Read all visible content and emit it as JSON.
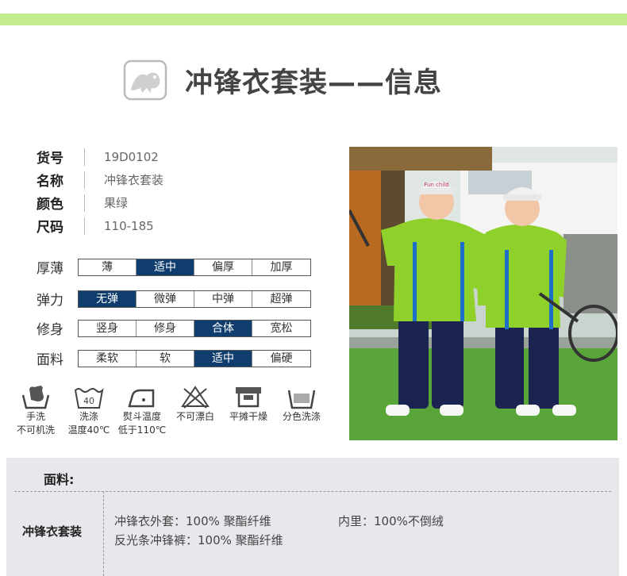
{
  "header": {
    "title": "冲锋衣套装——信息"
  },
  "info": [
    {
      "label": "货号",
      "value": "19D0102"
    },
    {
      "label": "名称",
      "value": "冲锋衣套装"
    },
    {
      "label": "颜色",
      "value": "果绿"
    },
    {
      "label": "尺码",
      "value": "110-185"
    }
  ],
  "scales": [
    {
      "label": "厚薄",
      "options": [
        "薄",
        "适中",
        "偏厚",
        "加厚"
      ],
      "selected": 1
    },
    {
      "label": "弹力",
      "options": [
        "无弹",
        "微弹",
        "中弹",
        "超弹"
      ],
      "selected": 0
    },
    {
      "label": "修身",
      "options": [
        "竖身",
        "修身",
        "合体",
        "宽松"
      ],
      "selected": 2
    },
    {
      "label": "面料",
      "options": [
        "柔软",
        "软",
        "适中",
        "偏硬"
      ],
      "selected": 2
    }
  ],
  "care": [
    {
      "icon": "hand-wash-icon",
      "line1": "手洗",
      "line2": "不可机洗"
    },
    {
      "icon": "wash-40-icon",
      "badge": "40",
      "line1": "洗涤",
      "line2": "温度40℃"
    },
    {
      "icon": "iron-icon",
      "line1": "熨斗温度",
      "line2": "低于110℃"
    },
    {
      "icon": "no-bleach-icon",
      "line1": "不可漂白",
      "line2": ""
    },
    {
      "icon": "flat-dry-icon",
      "line1": "平摊干燥",
      "line2": ""
    },
    {
      "icon": "separate-wash-icon",
      "line1": "分色洗涤",
      "line2": ""
    }
  ],
  "fabric": {
    "heading": "面料:",
    "name": "冲锋衣套装",
    "line1": "冲锋衣外套：100% 聚酯纤维",
    "line1b": "内里：100%不倒绒",
    "line2": "反光条冲锋裤：100% 聚酯纤维"
  },
  "photo": {
    "cap_text": "Fun child"
  },
  "colors": {
    "accent_green": "#c3ec8f",
    "selected_blue": "#0e3d6e",
    "fabric_bg": "#e6e8ec",
    "jacket_green": "#8fd12a",
    "pants_navy": "#1b2450"
  }
}
